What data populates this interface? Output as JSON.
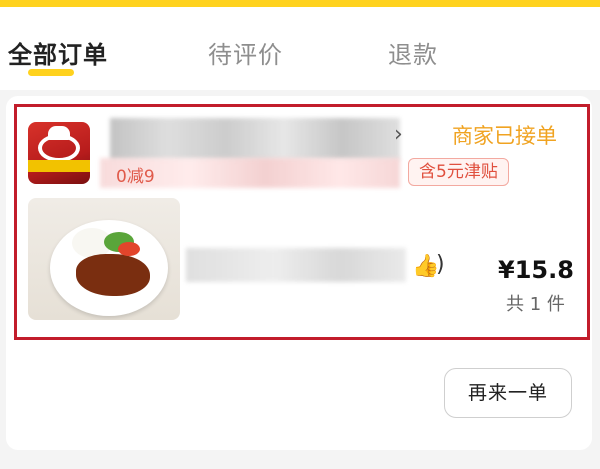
{
  "tabs": [
    {
      "label": "全部订单",
      "active": true
    },
    {
      "label": "待评价",
      "active": false
    },
    {
      "label": "退款",
      "active": false
    }
  ],
  "colors": {
    "accent": "#ffd21e",
    "highlight_border": "#c21d2b",
    "status": "#f0a321",
    "promo": "#e0503e"
  },
  "order": {
    "store_name_visible": "",
    "status": "商家已接单",
    "promo_discount": "0减9",
    "subsidy_tag": "含5元津贴",
    "item_emoji": "👍",
    "item_paren": ")",
    "price": "¥15.8",
    "quantity": "共 1 件",
    "chevron_icon": "chevron-right-icon"
  },
  "actions": {
    "reorder_label": "再来一单"
  }
}
